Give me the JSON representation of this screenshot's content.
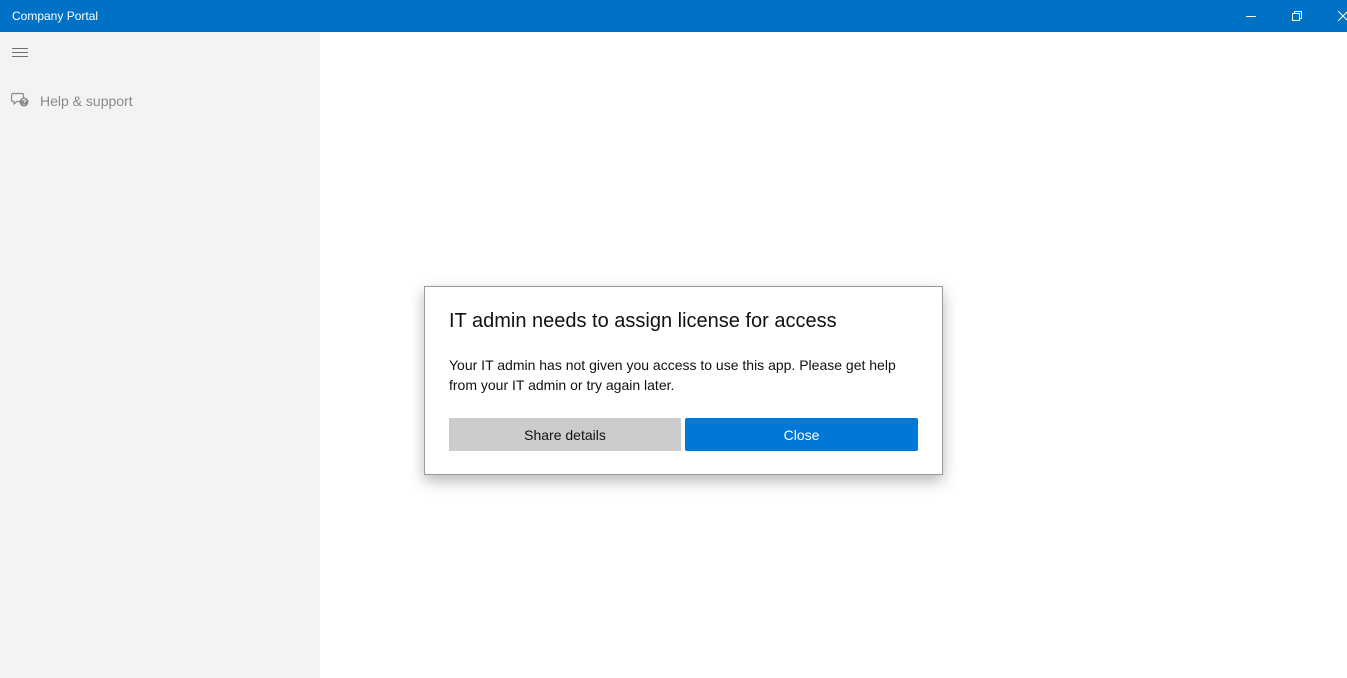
{
  "window": {
    "title": "Company Portal",
    "accent_color": "#0072c6",
    "controls": [
      "minimize-icon",
      "restore-icon",
      "close-icon"
    ]
  },
  "sidebar": {
    "menu_icon": "hamburger-icon",
    "items": [
      {
        "icon": "help-chat-icon",
        "label": "Help & support"
      }
    ]
  },
  "dialog": {
    "title": "IT admin needs to assign license for access",
    "message": "Your IT admin has not given you access to use this app. Please get help from your IT admin or try again later.",
    "buttons": {
      "share_details": "Share details",
      "close": "Close"
    },
    "primary_color": "#0078d7"
  }
}
